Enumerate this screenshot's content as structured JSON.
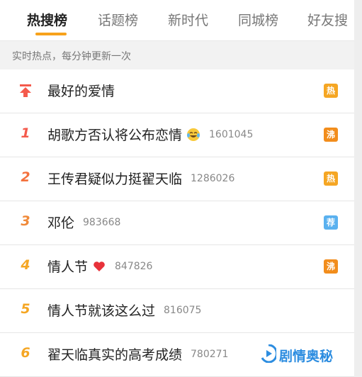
{
  "tabs": [
    {
      "label": "热搜榜",
      "active": true
    },
    {
      "label": "话题榜",
      "active": false
    },
    {
      "label": "新时代",
      "active": false
    },
    {
      "label": "同城榜",
      "active": false
    },
    {
      "label": "好友搜",
      "active": false
    }
  ],
  "subtitle": "实时热点，每分钟更新一次",
  "list": [
    {
      "rank": "",
      "rank_icon": "pinned-top-icon",
      "title": "最好的爱情",
      "count": "",
      "badge": "热",
      "badge_color": "#f5a623"
    },
    {
      "rank": "1",
      "title": "胡歌方否认将公布恋情",
      "emoji": "crying-laughing-emoji",
      "count": "1601045",
      "badge": "沸",
      "badge_color": "#f28d1c",
      "rank_color": "#f45a4c"
    },
    {
      "rank": "2",
      "title": "王传君疑似力挺翟天临",
      "count": "1286026",
      "badge": "热",
      "badge_color": "#f5a623",
      "rank_color": "#f4713d"
    },
    {
      "rank": "3",
      "title": "邓伦",
      "count": "983668",
      "badge": "荐",
      "badge_color": "#5ab1ef",
      "rank_color": "#f08a3a"
    },
    {
      "rank": "4",
      "title": "情人节",
      "emoji": "red-heart-emoji",
      "count": "847826",
      "badge": "沸",
      "badge_color": "#f28d1c",
      "rank_color": "#f5a623"
    },
    {
      "rank": "5",
      "title": "情人节就该这么过",
      "count": "816075",
      "badge": "",
      "rank_color": "#f5a623"
    },
    {
      "rank": "6",
      "title": "翟天临真实的高考成绩",
      "count": "780271",
      "badge": "",
      "badge_color": "#f28d1c",
      "rank_color": "#f5a623"
    }
  ],
  "watermark": {
    "text": "剧情奥秘",
    "icon": "play-logo-icon"
  },
  "colors": {
    "accent": "#f7a21b",
    "text": "#222222",
    "muted": "#888888"
  }
}
